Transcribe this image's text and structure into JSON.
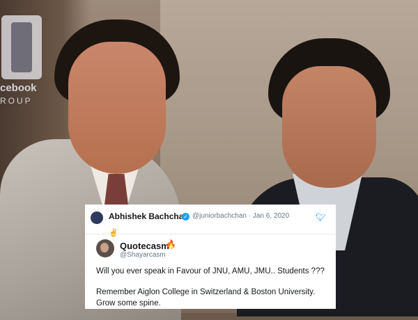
{
  "watermark": {
    "line1": "cebook",
    "line2": "ROUP"
  },
  "tweet": {
    "author": {
      "name": "Abhishek Bachchan",
      "handle_date": "@juniorbachchan · Jan 6, 2020",
      "emoji": "✌"
    },
    "quoted": {
      "name": "Quotecasm",
      "emoji": "🔥",
      "handle": "@Shayarcasm",
      "lines": [
        "Will you ever speak in Favour of JNU, AMU, JMU.. Students ???",
        "Remember Aiglon College in Switzerland & Boston University.",
        "Grow some spine."
      ]
    }
  },
  "icons": {
    "verified": "verified-badge-icon",
    "twitter": "twitter-bird-icon"
  },
  "colors": {
    "twitter_blue": "#1da1f2",
    "text": "#14171a",
    "muted": "#657786"
  }
}
